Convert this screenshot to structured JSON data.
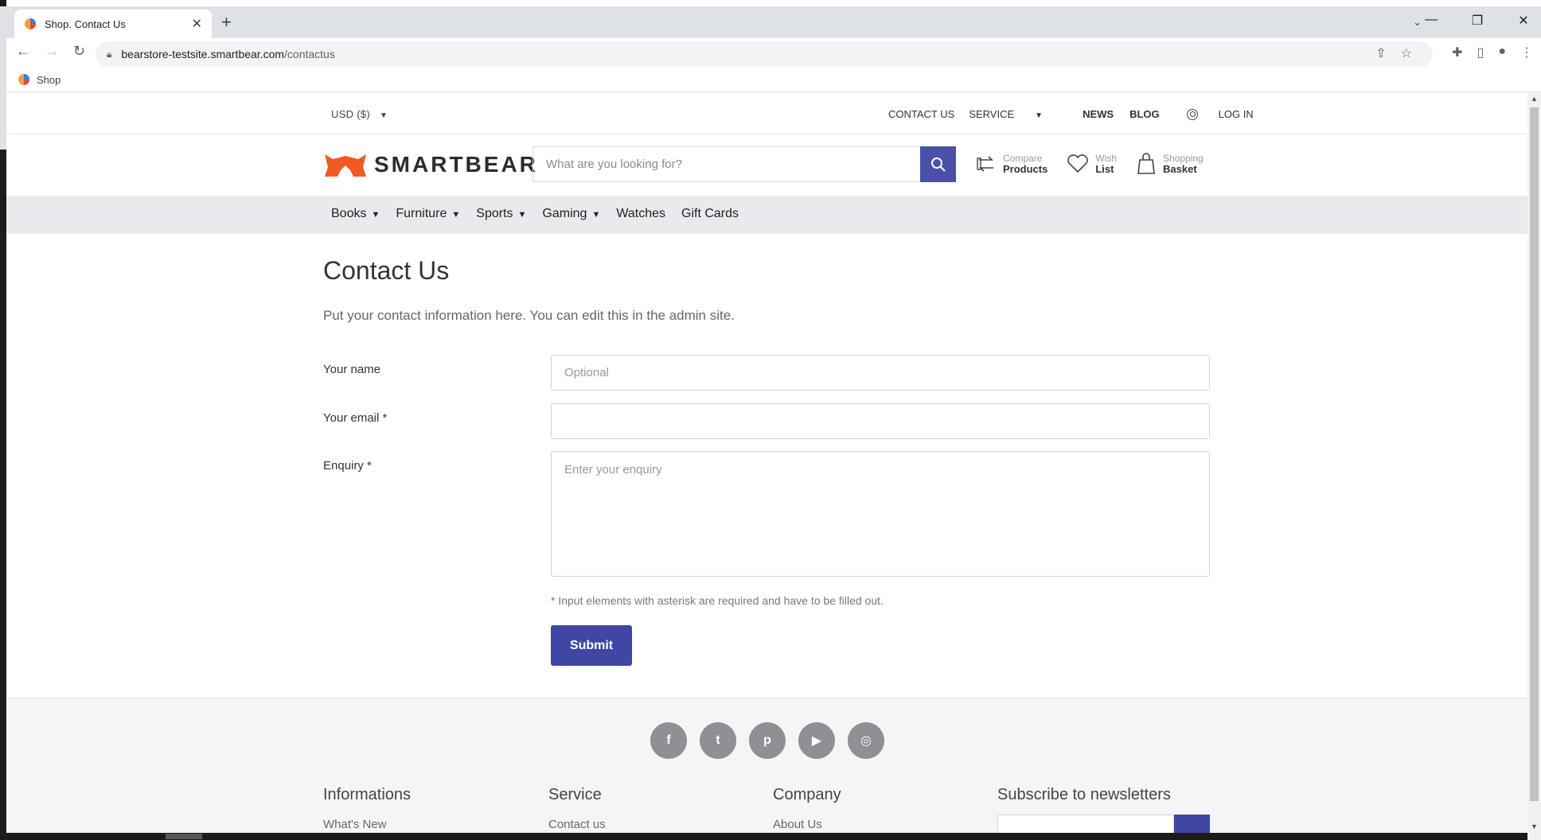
{
  "browser": {
    "tab_title": "Shop. Contact Us",
    "url_host": "bearstore-testsite.smartbear.com",
    "url_path": "/contactus",
    "bookmark_label": "Shop"
  },
  "topbar": {
    "currency": "USD  ($)",
    "contact": "CONTACT US",
    "service": "SERVICE",
    "news": "NEWS",
    "blog": "BLOG",
    "login": "LOG IN"
  },
  "header": {
    "logo_text": "SMARTBEAR",
    "search_placeholder": "What are you looking for?",
    "compare_top": "Compare",
    "compare_bottom": "Products",
    "wish_top": "Wish",
    "wish_bottom": "List",
    "basket_top": "Shopping",
    "basket_bottom": "Basket"
  },
  "nav": {
    "items": [
      {
        "label": "Books",
        "dropdown": true
      },
      {
        "label": "Furniture",
        "dropdown": true
      },
      {
        "label": "Sports",
        "dropdown": true
      },
      {
        "label": "Gaming",
        "dropdown": true
      },
      {
        "label": "Watches",
        "dropdown": false
      },
      {
        "label": "Gift Cards",
        "dropdown": false
      }
    ]
  },
  "main": {
    "title": "Contact Us",
    "subtitle": "Put your contact information here. You can edit this in the admin site.",
    "name_label": "Your name",
    "name_placeholder": "Optional",
    "email_label": "Your email *",
    "email_value": "",
    "enquiry_label": "Enquiry *",
    "enquiry_placeholder": "Enter your enquiry",
    "hint": "* Input elements with asterisk are required and have to be filled out.",
    "submit": "Submit"
  },
  "footer": {
    "socials": [
      "facebook-icon",
      "twitter-icon",
      "pinterest-icon",
      "youtube-icon",
      "instagram-icon"
    ],
    "col1_title": "Informations",
    "col1_link": "What's New",
    "col2_title": "Service",
    "col2_link": "Contact us",
    "col3_title": "Company",
    "col3_link": "About Us",
    "col4_title": "Subscribe to newsletters"
  },
  "colors": {
    "accent": "#3f46a3",
    "logo_orange": "#f15a22"
  }
}
